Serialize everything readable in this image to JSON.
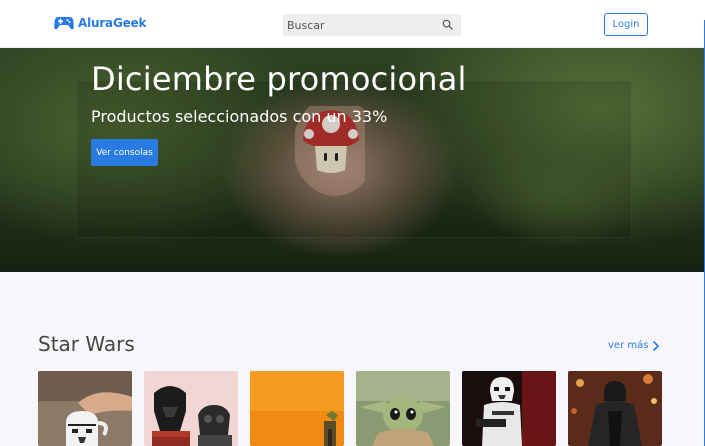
{
  "header": {
    "logo_text": "AluraGeek",
    "logo_icon": "gamepad-icon",
    "search": {
      "placeholder": "Buscar",
      "icon": "search-icon"
    },
    "login_label": "Login"
  },
  "hero": {
    "title": "Diciembre promocional",
    "subtitle": "Productos seleccionados con un 33%",
    "button_label": "Ver consolas"
  },
  "section": {
    "title": "Star Wars",
    "see_more_label": "ver más",
    "see_more_icon": "chevron-right-icon",
    "products": [
      {
        "image": "stormtrooper-mug-image"
      },
      {
        "image": "darth-vader-lego-image"
      },
      {
        "image": "yoda-figure-image"
      },
      {
        "image": "baby-yoda-image"
      },
      {
        "image": "stormtrooper-figure-image"
      },
      {
        "image": "kylo-ren-figure-image"
      }
    ]
  },
  "colors": {
    "accent": "#2a7ae4",
    "background": "#f7f7fb",
    "heading": "#464646"
  }
}
